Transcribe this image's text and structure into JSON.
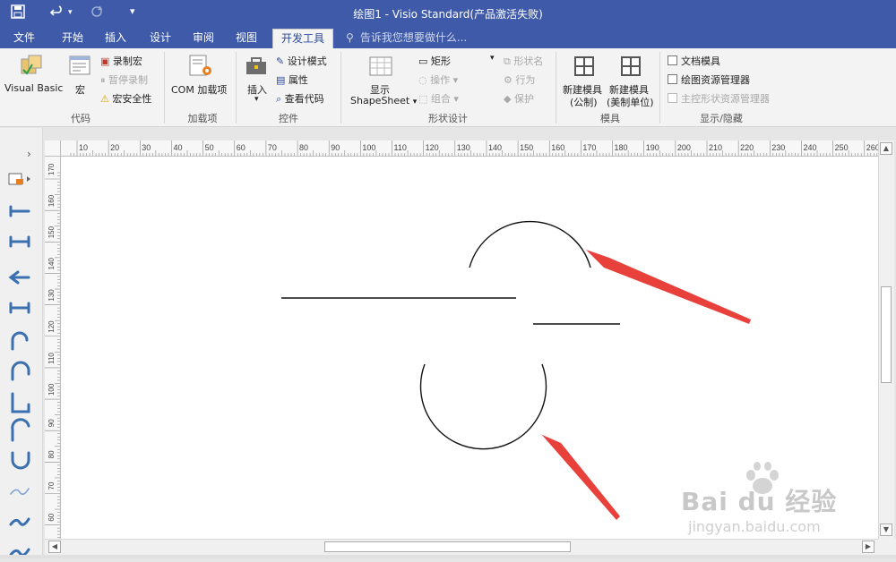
{
  "window": {
    "title": "绘图1 - Visio Standard(产品激活失败)"
  },
  "tabs": [
    {
      "label": "文件",
      "active": false
    },
    {
      "label": "开始",
      "active": false
    },
    {
      "label": "插入",
      "active": false
    },
    {
      "label": "设计",
      "active": false
    },
    {
      "label": "审阅",
      "active": false
    },
    {
      "label": "视图",
      "active": false
    },
    {
      "label": "开发工具",
      "active": true
    }
  ],
  "tell_me": "告诉我您想要做什么...",
  "ribbon": {
    "code": {
      "label": "代码",
      "visual_basic": "Visual Basic",
      "macros": "宏",
      "record_macro": "录制宏",
      "pause_recording": "暂停录制",
      "macro_security": "宏安全性"
    },
    "addins": {
      "label": "加载项",
      "com_addins": "COM 加载项"
    },
    "controls": {
      "label": "控件",
      "insert": "插入",
      "design_mode": "设计模式",
      "properties": "属性",
      "view_code": "查看代码"
    },
    "shape_design": {
      "label": "形状设计",
      "show": "显示",
      "shapesheet": "ShapeSheet",
      "rectangle": "矩形",
      "operations": "操作",
      "group": "组合",
      "shape_name": "形状名",
      "behavior": "行为",
      "protect": "保护"
    },
    "stencil": {
      "label": "模具",
      "new_metric_line1": "新建模具",
      "new_metric_line2": "(公制)",
      "new_us_line1": "新建模具",
      "new_us_line2": "(美制单位)"
    },
    "show_hide": {
      "label": "显示/隐藏",
      "document_stencil": "文档模具",
      "drawing_explorer": "绘图资源管理器",
      "master_explorer": "主控形状资源管理器"
    }
  },
  "ruler": {
    "top_ticks": [
      "10",
      "20",
      "30",
      "40",
      "50",
      "60",
      "70",
      "80",
      "90",
      "100",
      "110",
      "120",
      "130",
      "140",
      "150",
      "160",
      "170",
      "180",
      "190",
      "200",
      "210",
      "220",
      "230",
      "240",
      "250",
      "260"
    ],
    "left_ticks": [
      "170",
      "160",
      "150",
      "140",
      "130",
      "120",
      "110",
      "100",
      "90",
      "80",
      "70",
      "60"
    ]
  },
  "watermark": {
    "brand": "Bai du 经验",
    "url": "jingyan.baidu.com"
  },
  "colors": {
    "title_bar": "#3e5aa8",
    "arrow_red": "#e8403a",
    "ribbon_bg": "#f3f3f3",
    "shape_blue": "#3a6fb0"
  }
}
